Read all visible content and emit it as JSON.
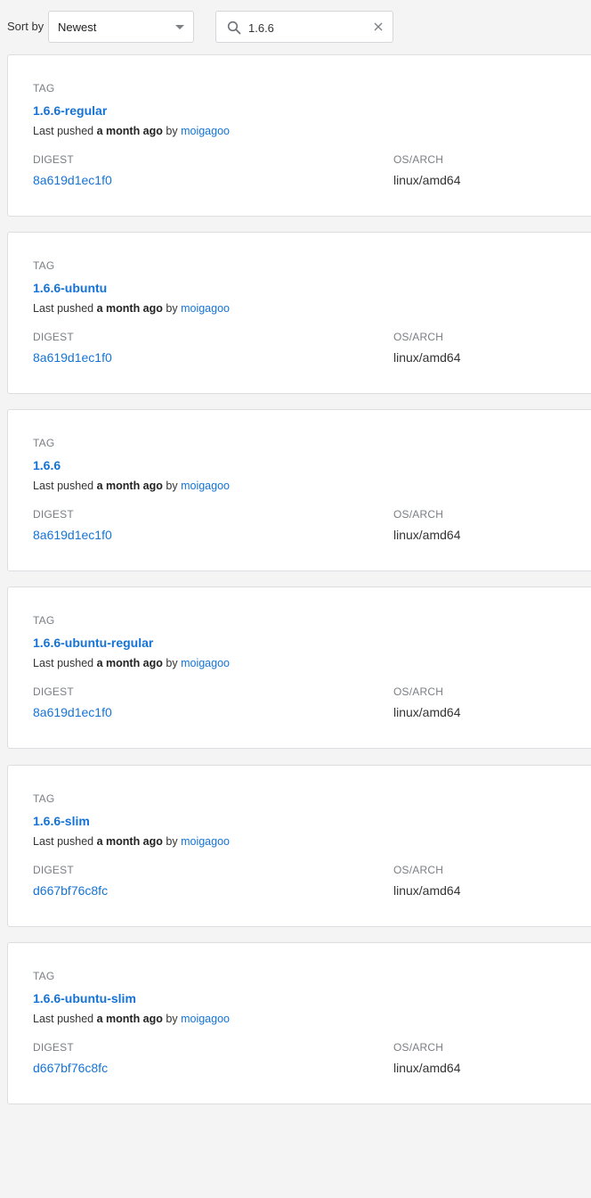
{
  "toolbar": {
    "sort_label": "Sort by",
    "sort_value": "Newest",
    "search_value": "1.6.6"
  },
  "labels": {
    "tag": "TAG",
    "digest": "DIGEST",
    "os_arch": "OS/ARCH",
    "last_pushed": "Last pushed",
    "by": "by"
  },
  "tags": [
    {
      "name": "1.6.6-regular",
      "pushed_time": "a month ago",
      "pushed_by": "moigagoo",
      "digest": "8a619d1ec1f0",
      "os_arch": "linux/amd64"
    },
    {
      "name": "1.6.6-ubuntu",
      "pushed_time": "a month ago",
      "pushed_by": "moigagoo",
      "digest": "8a619d1ec1f0",
      "os_arch": "linux/amd64"
    },
    {
      "name": "1.6.6",
      "pushed_time": "a month ago",
      "pushed_by": "moigagoo",
      "digest": "8a619d1ec1f0",
      "os_arch": "linux/amd64"
    },
    {
      "name": "1.6.6-ubuntu-regular",
      "pushed_time": "a month ago",
      "pushed_by": "moigagoo",
      "digest": "8a619d1ec1f0",
      "os_arch": "linux/amd64"
    },
    {
      "name": "1.6.6-slim",
      "pushed_time": "a month ago",
      "pushed_by": "moigagoo",
      "digest": "d667bf76c8fc",
      "os_arch": "linux/amd64"
    },
    {
      "name": "1.6.6-ubuntu-slim",
      "pushed_time": "a month ago",
      "pushed_by": "moigagoo",
      "digest": "d667bf76c8fc",
      "os_arch": "linux/amd64"
    }
  ]
}
